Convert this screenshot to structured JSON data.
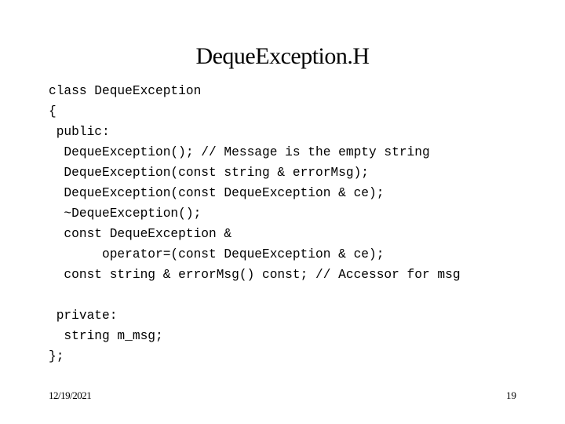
{
  "slide": {
    "title": "DequeException.H",
    "code_lines": [
      "class DequeException",
      "{",
      " public:",
      "  DequeException(); // Message is the empty string",
      "  DequeException(const string & errorMsg);",
      "  DequeException(const DequeException & ce);",
      "  ~DequeException();",
      "  const DequeException &",
      "       operator=(const DequeException & ce);",
      "  const string & errorMsg() const; // Accessor for msg",
      "",
      " private:",
      "  string m_msg;",
      "};"
    ],
    "footer": {
      "date": "12/19/2021",
      "page_number": "19"
    }
  }
}
